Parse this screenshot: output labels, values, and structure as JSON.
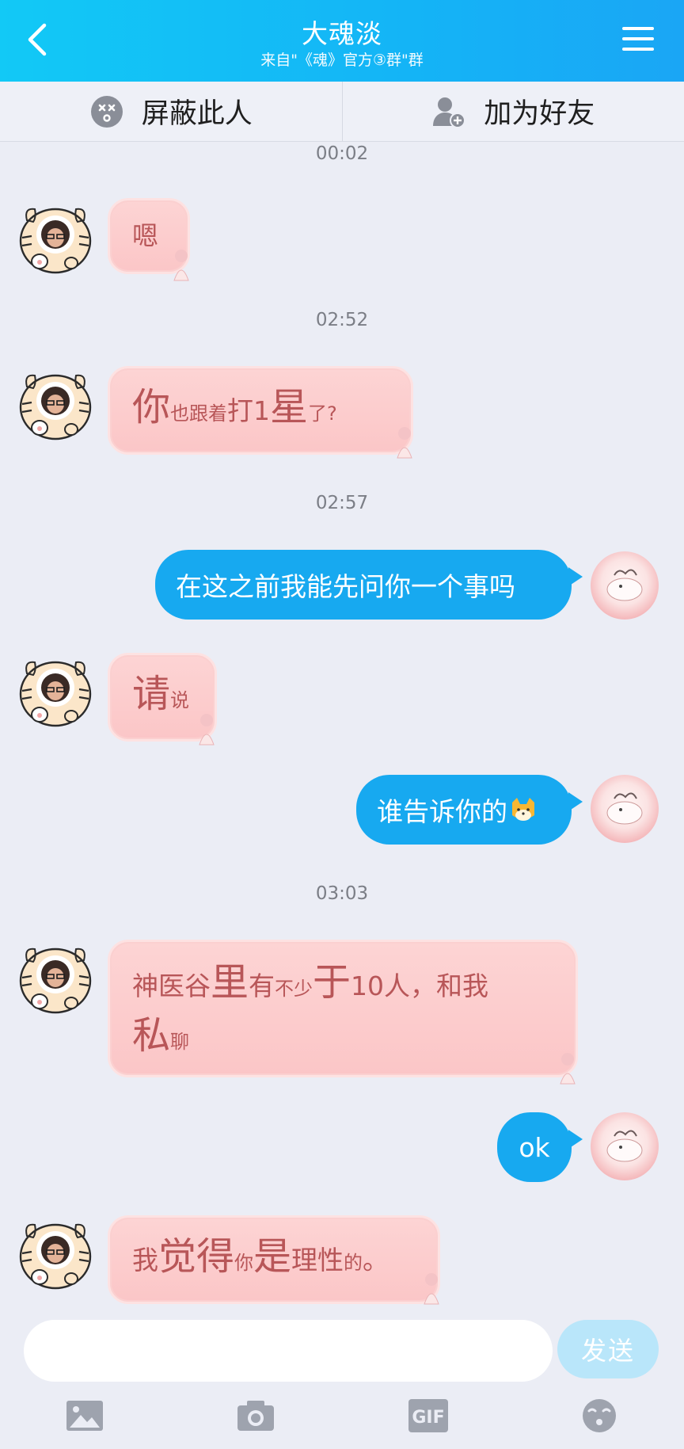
{
  "header": {
    "title": "大魂淡",
    "subtitle": "来自\"《魂》官方③群\"群"
  },
  "actions": {
    "block_label": "屏蔽此人",
    "add_friend_label": "加为好友"
  },
  "timestamps": [
    "00:02",
    "02:52",
    "02:57",
    "03:03"
  ],
  "messages": [
    {
      "side": "left",
      "parts": [
        {
          "text": "嗯",
          "size": "mid"
        }
      ]
    },
    {
      "side": "left",
      "parts": [
        {
          "text": "你",
          "size": "big"
        },
        {
          "text": "也跟着",
          "size": "sm"
        },
        {
          "text": "打1",
          "size": "mid"
        },
        {
          "text": "星",
          "size": "big"
        },
        {
          "text": "了?",
          "size": "sm"
        }
      ]
    },
    {
      "side": "right",
      "text": "在这之前我能先问你一个事吗"
    },
    {
      "side": "left",
      "parts": [
        {
          "text": "请",
          "size": "big"
        },
        {
          "text": "说",
          "size": "sm"
        }
      ]
    },
    {
      "side": "right",
      "text": "谁告诉你的",
      "emoji": "shiba-face-emoji"
    },
    {
      "side": "left",
      "parts": [
        {
          "text": "神医谷",
          "size": "mid"
        },
        {
          "text": "里",
          "size": "big"
        },
        {
          "text": "有",
          "size": "mid"
        },
        {
          "text": "不少",
          "size": "sm"
        },
        {
          "text": "于",
          "size": "big"
        },
        {
          "text": "10人，和我",
          "size": "mid"
        }
      ],
      "parts_line2": [
        {
          "text": "私",
          "size": "big"
        },
        {
          "text": "聊",
          "size": "sm"
        }
      ]
    },
    {
      "side": "right",
      "text": "ok"
    },
    {
      "side": "left",
      "parts": [
        {
          "text": "我",
          "size": "mid"
        },
        {
          "text": "觉得",
          "size": "big"
        },
        {
          "text": "你",
          "size": "sm"
        },
        {
          "text": "是",
          "size": "big"
        },
        {
          "text": "理性",
          "size": "mid"
        },
        {
          "text": "的",
          "size": "sm"
        },
        {
          "text": "。",
          "size": "mid"
        }
      ]
    }
  ],
  "input": {
    "value": "",
    "send_label": "发送"
  },
  "toolbar": {
    "items": [
      "image-icon",
      "camera-icon",
      "gif-icon",
      "emoji-icon"
    ],
    "gif_label": "GIF"
  },
  "colors": {
    "header_gradient_start": "#12c9f6",
    "header_gradient_end": "#1aa6f5",
    "pink_bubble": "#fbc6c7",
    "pink_text": "#b85658",
    "blue_bubble": "#17a9f0",
    "send_disabled": "#b9e6fa",
    "background": "#ebedf5"
  }
}
